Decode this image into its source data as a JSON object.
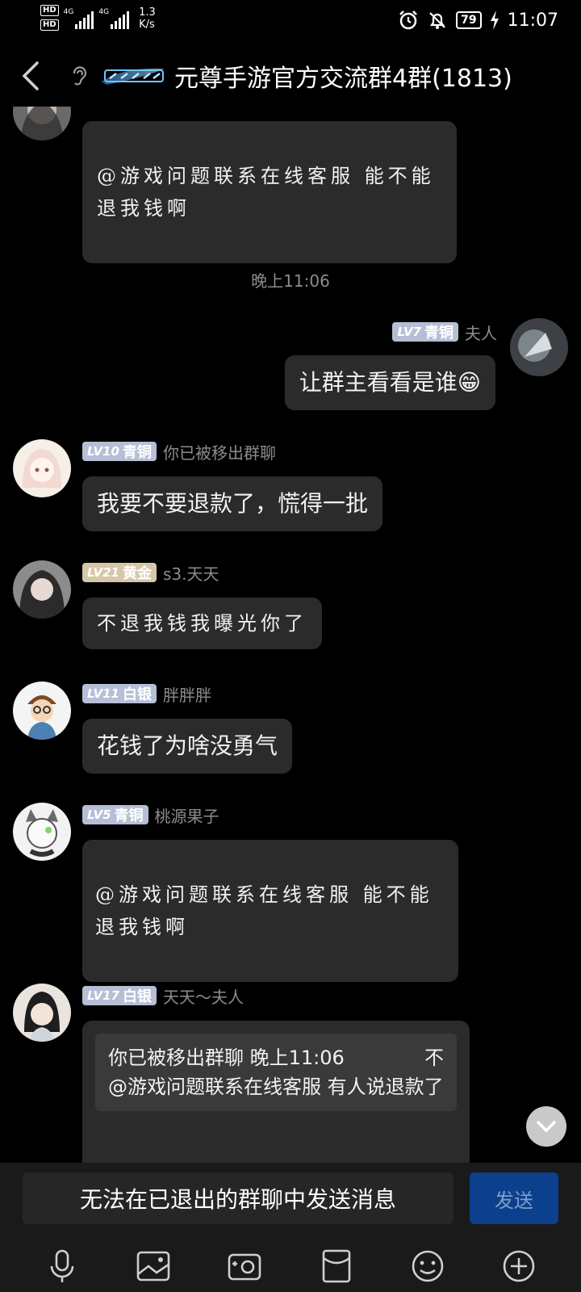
{
  "status_bar": {
    "hd1": "HD",
    "hd2": "HD",
    "net1": "4G",
    "net2": "4G",
    "speed_value": "1.3",
    "speed_unit": "K/s",
    "battery": "79",
    "time": "11:07"
  },
  "header": {
    "title": "元尊手游官方交流群4群(1813)"
  },
  "messages": [
    {
      "text": "@游戏问题联系在线客服 能不能退我钱啊"
    },
    {
      "timestamp": "晚上11:06"
    },
    {
      "level": "LV7",
      "rank": "青铜",
      "sender": "夫人",
      "text": "让群主看看是谁😁"
    },
    {
      "level": "LV10",
      "rank": "青铜",
      "sender": "你已被移出群聊",
      "text": "我要不要退款了，慌得一批"
    },
    {
      "level": "LV21",
      "rank": "黄金",
      "sender": "s3.天天",
      "text": "不退我钱我曝光你了"
    },
    {
      "level": "LV11",
      "rank": "白银",
      "sender": "胖胖胖",
      "text": "花钱了为啥没勇气"
    },
    {
      "level": "LV5",
      "rank": "青铜",
      "sender": "桃源果子",
      "text": "@游戏问题联系在线客服 能不能退我钱啊"
    },
    {
      "level": "LV17",
      "rank": "白银",
      "sender": "天天～夫人",
      "quote_head": "你已被移出群聊 晚上11:06",
      "quote_mark": "不",
      "quote_text": "@游戏问题联系在线客服 有人说退款了"
    }
  ],
  "input": {
    "placeholder": "无法在已退出的群聊中发送消息",
    "send_label": "发送"
  },
  "toolbar_icons": [
    "mic-icon",
    "image-icon",
    "camera-icon",
    "red-packet-icon",
    "emoji-icon",
    "plus-icon"
  ],
  "colors": {
    "background": "#000000",
    "bubble": "#2b2b2b",
    "badge_bronze": "#b7bfd6",
    "send_button": "#0c3f8c"
  }
}
